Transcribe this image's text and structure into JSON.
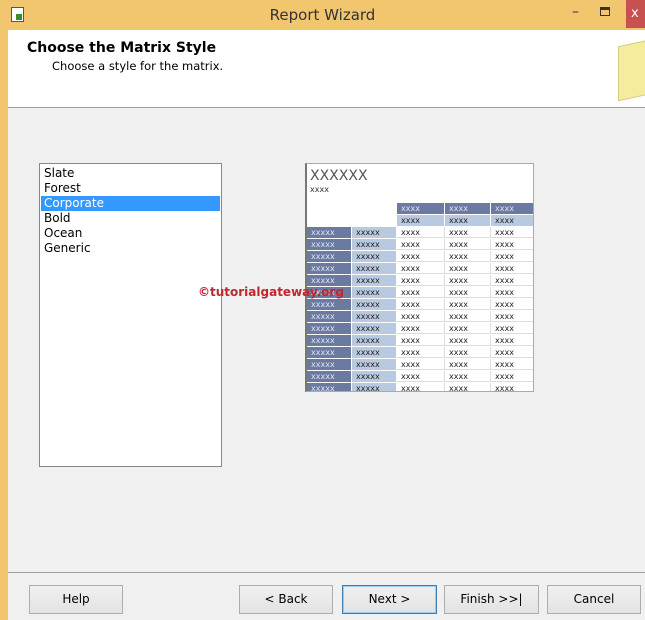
{
  "window": {
    "title": "Report Wizard",
    "close_glyph": "x",
    "minimize_glyph": "–"
  },
  "header": {
    "title": "Choose the Matrix Style",
    "subtitle": "Choose a style for the matrix."
  },
  "styles": {
    "items": [
      "Slate",
      "Forest",
      "Corporate",
      "Bold",
      "Ocean",
      "Generic"
    ],
    "selected": "Corporate"
  },
  "preview": {
    "title": "XXXXXX",
    "subtitle": "xxxx",
    "col_header": "xxxx",
    "row_header": "xxxxx",
    "cell": "xxxx",
    "rows": 14
  },
  "watermark": "©tutorialgateway.org",
  "buttons": {
    "help": "Help",
    "back": "< Back",
    "next": "Next >",
    "finish": "Finish >>|",
    "cancel": "Cancel"
  },
  "colors": {
    "titlebar": "#f1c66f",
    "selection": "#3399ff",
    "dark_header": "#6a7aa0",
    "light_header": "#b9c9e0"
  }
}
